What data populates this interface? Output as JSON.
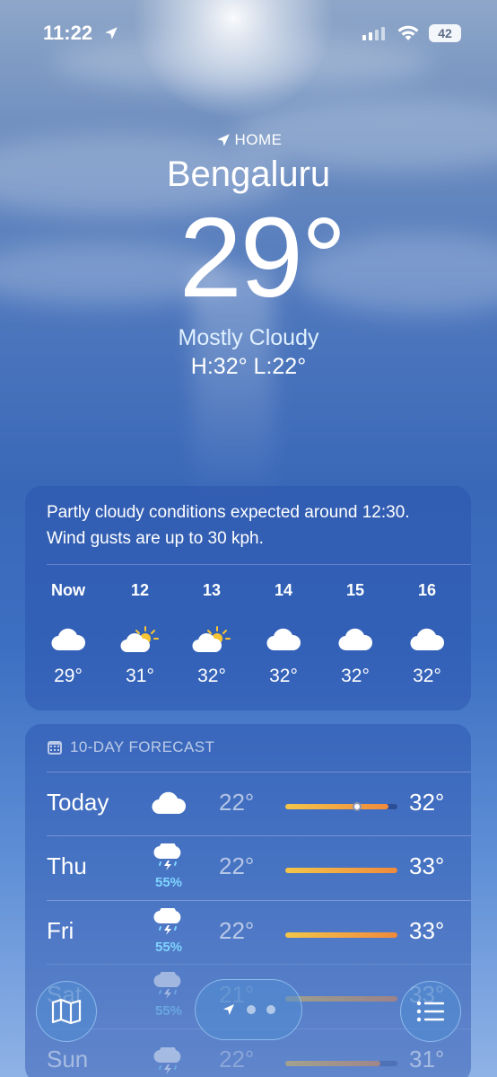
{
  "status_bar": {
    "time": "11:22",
    "battery": "42"
  },
  "header": {
    "home_label": "HOME",
    "city": "Bengaluru",
    "temperature": "29°",
    "condition": "Mostly Cloudy",
    "high_low": "H:32°  L:22°"
  },
  "hourly": {
    "summary": "Partly cloudy conditions expected around 12:30. Wind gusts are up to 30 kph.",
    "hours": [
      {
        "label": "Now",
        "icon": "cloud-icon",
        "temp": "29°"
      },
      {
        "label": "12",
        "icon": "partly-sunny-icon",
        "temp": "31°"
      },
      {
        "label": "13",
        "icon": "partly-sunny-icon",
        "temp": "32°"
      },
      {
        "label": "14",
        "icon": "cloud-icon",
        "temp": "32°"
      },
      {
        "label": "15",
        "icon": "cloud-icon",
        "temp": "32°"
      },
      {
        "label": "16",
        "icon": "cloud-icon",
        "temp": "32°"
      }
    ]
  },
  "daily": {
    "header": "10-DAY FORECAST",
    "rows": [
      {
        "day": "Today",
        "icon": "cloud-icon",
        "precip": "",
        "low": "22°",
        "high": "32°",
        "range": [
          0.0,
          0.92
        ],
        "current": 0.64
      },
      {
        "day": "Thu",
        "icon": "thunderstorm-icon",
        "precip": "55%",
        "low": "22°",
        "high": "33°",
        "range": [
          0.0,
          1.0
        ]
      },
      {
        "day": "Fri",
        "icon": "thunderstorm-icon",
        "precip": "55%",
        "low": "22°",
        "high": "33°",
        "range": [
          0.0,
          1.0
        ]
      },
      {
        "day": "Sat",
        "icon": "thunderstorm-icon",
        "precip": "55%",
        "low": "21°",
        "high": "33°",
        "range": [
          0.0,
          1.0
        ]
      },
      {
        "day": "Sun",
        "icon": "thunderstorm-icon",
        "precip": "",
        "low": "22°",
        "high": "31°",
        "range": [
          0.0,
          0.85
        ]
      }
    ]
  },
  "colors": {
    "precip": "#7fd4ff",
    "range_start": "#f3c649",
    "range_end": "#f08a3c"
  }
}
